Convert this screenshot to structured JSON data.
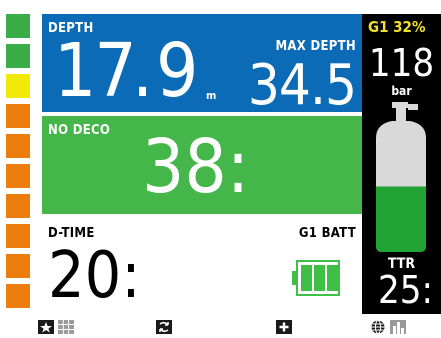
{
  "colors": {
    "depth_panel": "#0c6bb6",
    "nodeco_panel": "#45b649",
    "tank_panel": "#000000",
    "gas_label": "#f0e028",
    "ascent_green": "#3aad48",
    "ascent_yellow": "#f4ea0a",
    "ascent_orange": "#ee7d0f",
    "battery": "#3fbf45",
    "cylinder_empty": "#d9d9d9",
    "cylinder_full": "#21a336"
  },
  "ascent_rate": {
    "segments": [
      "green",
      "green",
      "yellow",
      "orange",
      "orange",
      "orange",
      "orange",
      "orange",
      "orange",
      "orange"
    ]
  },
  "depth": {
    "label": "DEPTH",
    "value_int": "17",
    "value_dot": ".",
    "value_dec": "9",
    "unit": "m",
    "max_label": "MAX DEPTH",
    "max_value": "34.5"
  },
  "nodeco": {
    "label": "NO DECO",
    "value": "38:"
  },
  "dive_time": {
    "label": "D-TIME",
    "value": "20:"
  },
  "battery": {
    "label": "G1 BATT",
    "level_bars": 3
  },
  "tank": {
    "gas_label": "G1 32%",
    "pressure_value": "118",
    "pressure_unit": "bar",
    "fill_fraction": 0.5,
    "ttr_label": "TTR",
    "ttr_value": "25:"
  },
  "icon_bar": {
    "icons": [
      "light-icon",
      "compass-grid-icon",
      "switch-gas-icon",
      "plus-icon",
      "globe-icon",
      "bar-chart-icon"
    ]
  }
}
